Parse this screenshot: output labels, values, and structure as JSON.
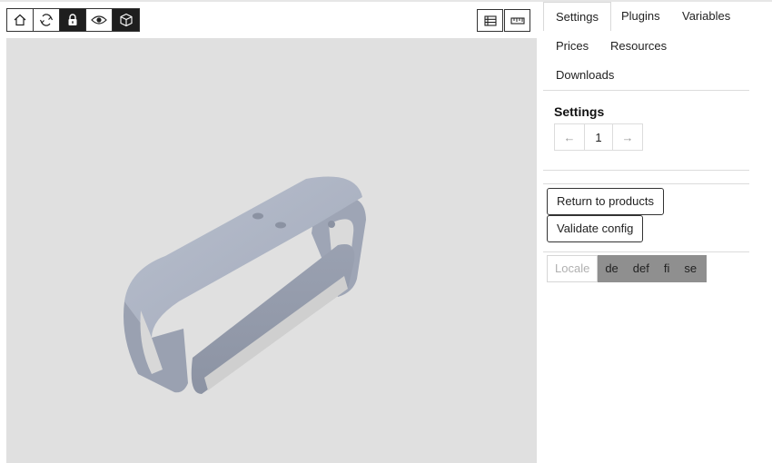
{
  "toolbar": {
    "left_buttons": [
      {
        "icon": "home-icon",
        "active": false
      },
      {
        "icon": "refresh-icon",
        "active": false
      },
      {
        "icon": "lock-icon",
        "active": true
      },
      {
        "icon": "eye-icon",
        "active": false
      },
      {
        "icon": "cube-icon",
        "active": true
      }
    ],
    "right_buttons": [
      {
        "icon": "list-icon"
      },
      {
        "icon": "ruler-icon"
      }
    ]
  },
  "tabs": [
    "Settings",
    "Plugins",
    "Variables",
    "Prices",
    "Resources",
    "Downloads"
  ],
  "active_tab": "Settings",
  "settings": {
    "title": "Settings",
    "pager": {
      "prev": "←",
      "page": "1",
      "next": "→"
    }
  },
  "actions": {
    "return_label": "Return to products",
    "validate_label": "Validate config"
  },
  "locale": {
    "label": "Locale",
    "options": [
      "de",
      "def",
      "fi",
      "se"
    ]
  },
  "colors": {
    "viewer_bg": "#e0e0e0",
    "model": "#a9b0c0",
    "toolbar_active": "#1e1e1e",
    "locale_bg": "#8f8f8f"
  }
}
